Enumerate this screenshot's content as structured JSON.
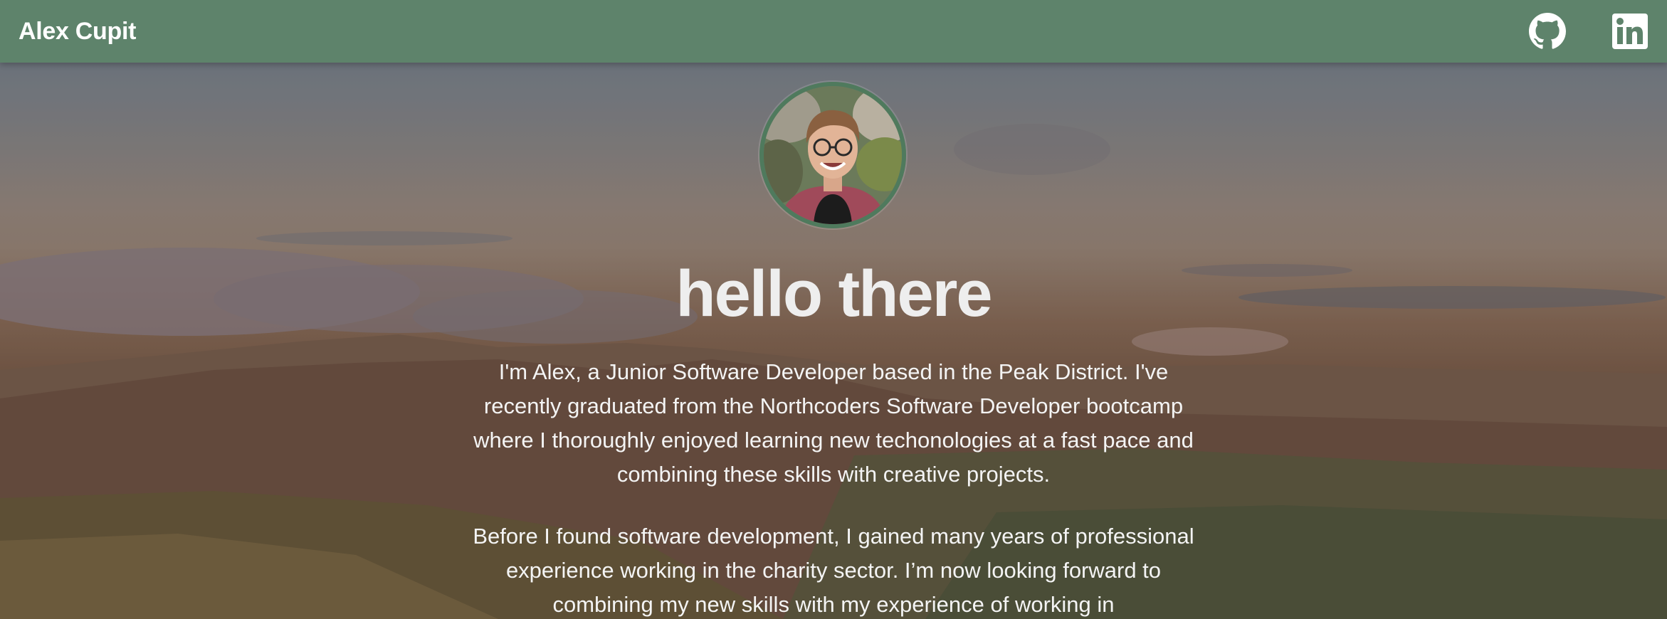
{
  "navbar": {
    "brand": "Alex Cupit",
    "icons": [
      "github-icon",
      "linkedin-icon"
    ]
  },
  "hero": {
    "heading": "hello there",
    "paragraphs": [
      "I'm Alex, a Junior Software Developer based in the Peak District. I've recently graduated from the Northcoders Software Developer bootcamp where I thoroughly enjoyed learning new techonologies at a fast pace and combining these skills with creative projects.",
      "Before I found software development, I gained many years of professional experience working in the charity sector. I’m now looking forward to combining my new skills with my experience of working in"
    ]
  },
  "colors": {
    "navbar": "#5e836b",
    "avatar_border": "#4f7a5d",
    "text": "#ffffff"
  }
}
